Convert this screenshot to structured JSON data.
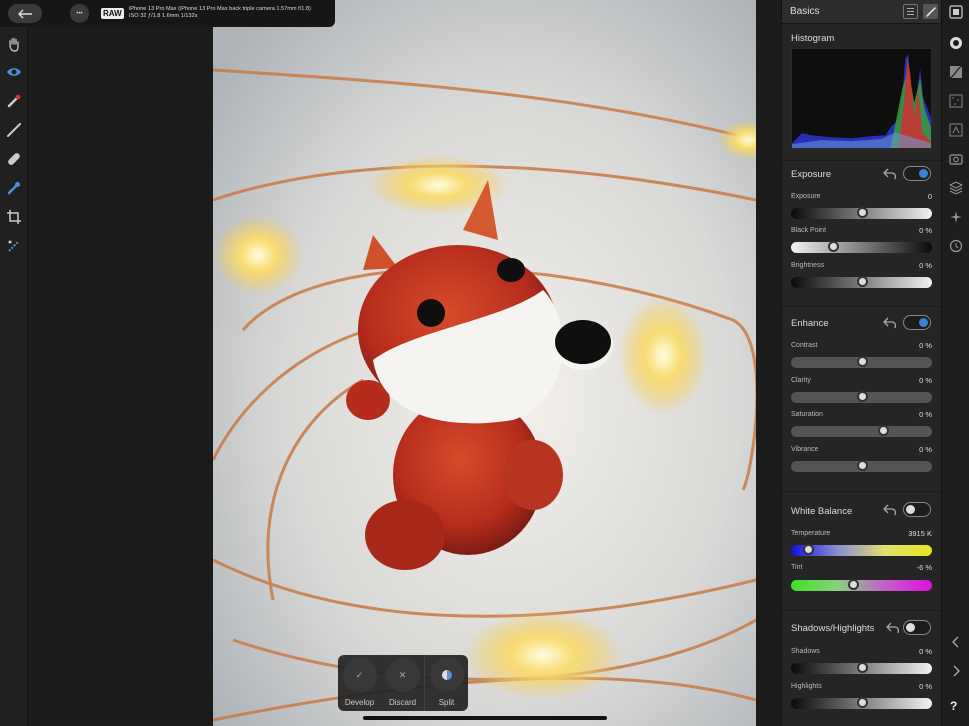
{
  "topbar": {
    "raw_badge": "RAW",
    "camera_line1": "iPhone 13 Pro Max (iPhone 13 Pro Max back triple camera 1.57mm f/1.8)",
    "camera_line2": "ISO 32 ƒ/1.8 1.6mm 1/132s",
    "more_label": "•••"
  },
  "panel": {
    "title": "Basics",
    "histogram_title": "Histogram",
    "sections": {
      "exposure": {
        "title": "Exposure",
        "enabled": true,
        "sliders": [
          {
            "label": "Exposure",
            "value": "0",
            "position": 0.5
          },
          {
            "label": "Black Point",
            "value": "0 %",
            "position": 0.3
          },
          {
            "label": "Brightness",
            "value": "0 %",
            "position": 0.5
          }
        ]
      },
      "enhance": {
        "title": "Enhance",
        "enabled": true,
        "sliders": [
          {
            "label": "Contrast",
            "value": "0 %",
            "position": 0.5
          },
          {
            "label": "Clarity",
            "value": "0 %",
            "position": 0.5
          },
          {
            "label": "Saturation",
            "value": "0 %",
            "position": 0.65
          },
          {
            "label": "Vibrance",
            "value": "0 %",
            "position": 0.5
          }
        ]
      },
      "white_balance": {
        "title": "White Balance",
        "enabled": false,
        "sliders": [
          {
            "label": "Temperature",
            "value": "3915 K",
            "position": 0.12
          },
          {
            "label": "Tint",
            "value": "-6 %",
            "position": 0.44
          }
        ]
      },
      "shadows_highlights": {
        "title": "Shadows/Highlights",
        "enabled": false,
        "sliders": [
          {
            "label": "Shadows",
            "value": "0 %",
            "position": 0.5
          },
          {
            "label": "Highlights",
            "value": "0 %",
            "position": 0.5
          }
        ]
      }
    }
  },
  "actions": {
    "develop": "Develop",
    "discard": "Discard",
    "split": "Split",
    "develop_glyph": "✓",
    "discard_glyph": "✕"
  },
  "studio": {
    "help_label": "?"
  },
  "colors": {
    "accent": "#3b7fd6",
    "panel_bg": "#252525"
  }
}
